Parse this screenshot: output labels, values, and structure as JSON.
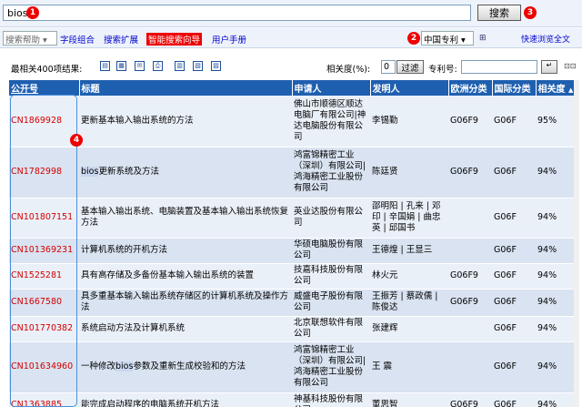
{
  "search": {
    "query": "bios",
    "button_label": "搜索"
  },
  "badges": {
    "b1": "1",
    "b2": "2",
    "b3": "3",
    "b4": "4"
  },
  "toolbar": {
    "help_select": "搜索帮助",
    "links": [
      "字段组合",
      "搜索扩展",
      "智能搜索向导",
      "用户手册"
    ],
    "country_select": "中国专利",
    "fast_browse": "快速浏览全文"
  },
  "results_bar": {
    "count_text": "最相关400项结果:",
    "relevance_label": "相关度(%):",
    "relevance_value": "0",
    "filter_label": "过滤",
    "patent_no_label": "专利号:"
  },
  "table": {
    "headers": [
      "公开号",
      "标题",
      "申请人",
      "发明人",
      "欧洲分类",
      "国际分类",
      "相关度"
    ],
    "rows": [
      {
        "pubno": "CN1869928",
        "title": "更新基本输入输出系统的方法",
        "applicant": "佛山市顺德区顺达电脑厂有限公司|神达电脑股份有限公司",
        "inventor": "李锡勤",
        "ecla": "G06F9",
        "ipc": "G06F",
        "relevance": "95%"
      },
      {
        "pubno": "CN1782998",
        "title_pre": "",
        "title_hl": "bios",
        "title_post": "更新系统及方法",
        "applicant": "鸿富锦精密工业（深圳）有限公司|鸿海精密工业股份有限公司",
        "inventor": "陈廷贤",
        "ecla": "G06F9",
        "ipc": "G06F",
        "relevance": "94%"
      },
      {
        "pubno": "CN101807151",
        "title": "基本输入输出系统、电脑装置及基本输入输出系统恢复方法",
        "applicant": "英业达股份有限公司",
        "inventor": "邵明阳 | 孔来 | 邓印 | 辛国娟 | 曲忠英 | 邱国书",
        "ecla": "",
        "ipc": "G06F",
        "relevance": "94%"
      },
      {
        "pubno": "CN101369231",
        "title": "计算机系统的开机方法",
        "applicant": "华硕电脑股份有限公司",
        "inventor": "王德煌 | 王显三",
        "ecla": "",
        "ipc": "G06F",
        "relevance": "94%"
      },
      {
        "pubno": "CN1525281",
        "title": "具有高存储及多备份基本输入输出系统的装置",
        "applicant": "技嘉科技股份有限公司",
        "inventor": "林火元",
        "ecla": "G06F9",
        "ipc": "G06F",
        "relevance": "94%"
      },
      {
        "pubno": "CN1667580",
        "title": "具多重基本输入输出系统存储区的计算机系统及操作方法",
        "applicant": "威盛电子股份有限公司",
        "inventor": "王振芳 | 蔡政儒 | 陈俊达",
        "ecla": "G06F9",
        "ipc": "G06F",
        "relevance": "94%"
      },
      {
        "pubno": "CN101770382",
        "title": "系统启动方法及计算机系统",
        "applicant": "北京联想软件有限公司",
        "inventor": "张建辉",
        "ecla": "",
        "ipc": "G06F",
        "relevance": "94%"
      },
      {
        "pubno": "CN101634960",
        "title_pre": "一种修改",
        "title_hl": "bios",
        "title_post": "参数及重新生成校验和的方法",
        "applicant": "鸿富锦精密工业（深圳）有限公司|鸿海精密工业股份有限公司",
        "inventor": "王 震",
        "ecla": "",
        "ipc": "G06F",
        "relevance": "94%"
      },
      {
        "pubno": "CN1363885",
        "title": "能完成启动程序的电脑系统开机方法",
        "applicant": "神基科技股份有限公司",
        "inventor": "董思智",
        "ecla": "G06F9",
        "ipc": "G06F",
        "relevance": "94%"
      }
    ]
  },
  "colors": {
    "header_bg": "#1f5fb0",
    "link": "#0000cc",
    "accent_red": "#e00000",
    "pubno": "#d40000"
  }
}
